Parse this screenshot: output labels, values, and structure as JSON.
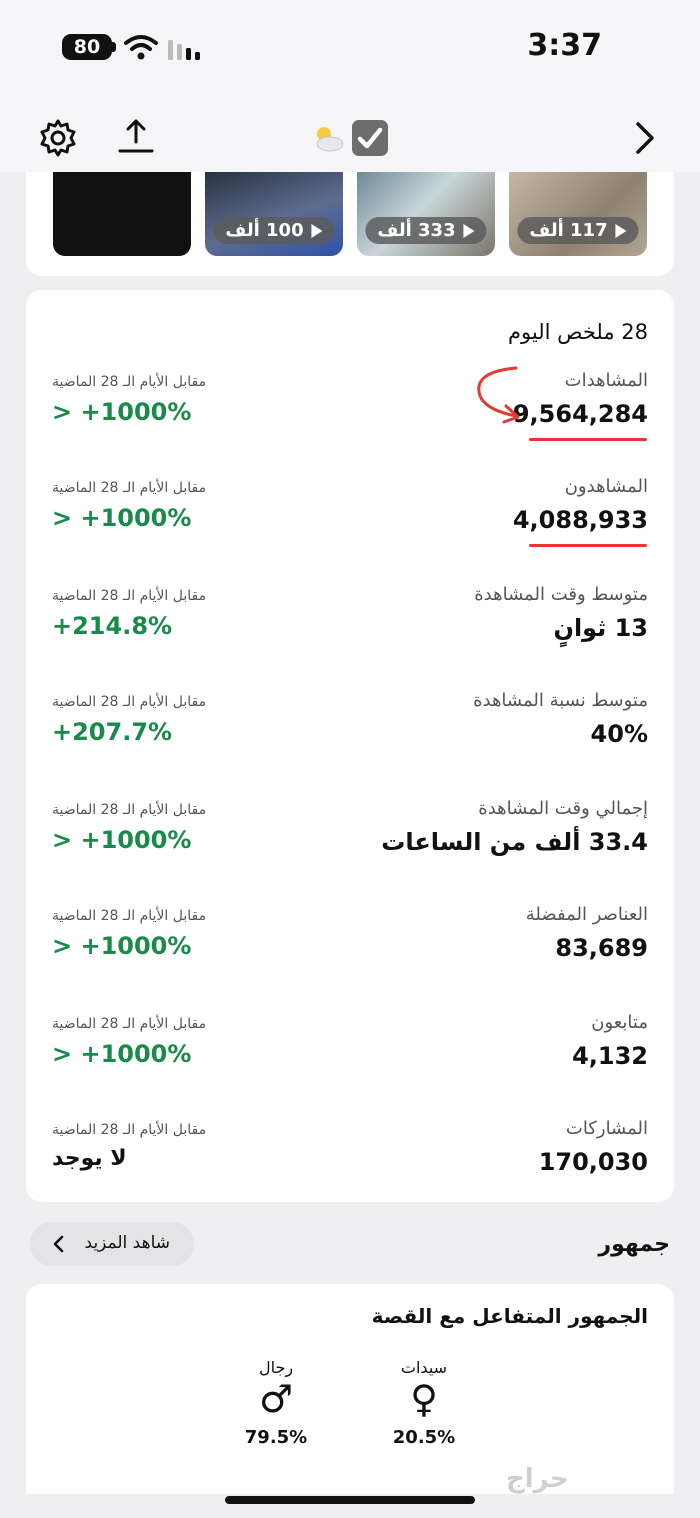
{
  "status_bar": {
    "battery": "80",
    "time": "3:37"
  },
  "thumbnails": [
    {
      "views": "",
      "bg": "#111111"
    },
    {
      "views": "100 ألف",
      "bg": "#3b4f7d"
    },
    {
      "views": "333 ألف",
      "bg": "#8fa3a8"
    },
    {
      "views": "117 ألف",
      "bg": "#a89a88"
    }
  ],
  "summary": {
    "title": "28 ملخص اليوم",
    "compare_label": "مقابل الأيام الـ 28 الماضية",
    "metrics": [
      {
        "label": "المشاهدات",
        "value": "9,564,284",
        "change": "> +1000%"
      },
      {
        "label": "المشاهدون",
        "value": "4,088,933",
        "change": "> +1000%"
      },
      {
        "label": "متوسط وقت المشاهدة",
        "value": "13 ثوانٍ",
        "change": "+214.8%"
      },
      {
        "label": "متوسط نسبة المشاهدة",
        "value": "40%",
        "change": "+207.7%"
      },
      {
        "label": "إجمالي وقت المشاهدة",
        "value": "33.4 ألف من الساعات",
        "change": "> +1000%"
      },
      {
        "label": "العناصر المفضلة",
        "value": "83,689",
        "change": "> +1000%"
      },
      {
        "label": "متابعون",
        "value": "4,132",
        "change": "> +1000%"
      },
      {
        "label": "المشاركات",
        "value": "170,030",
        "change": "لا يوجد"
      }
    ]
  },
  "audience": {
    "header": "جمهور",
    "see_more": "شاهد المزيد",
    "card_title": "الجمهور المتفاعل مع القصة",
    "women_label": "سيدات",
    "women_symbol": "♀",
    "women_value": "20.5%",
    "men_label": "رجال",
    "men_symbol": "♂",
    "men_value": "79.5%"
  },
  "watermark": "حراج",
  "colors": {
    "positive": "#1a8a4a",
    "annotation": "#e53935",
    "background": "#efeff1"
  }
}
